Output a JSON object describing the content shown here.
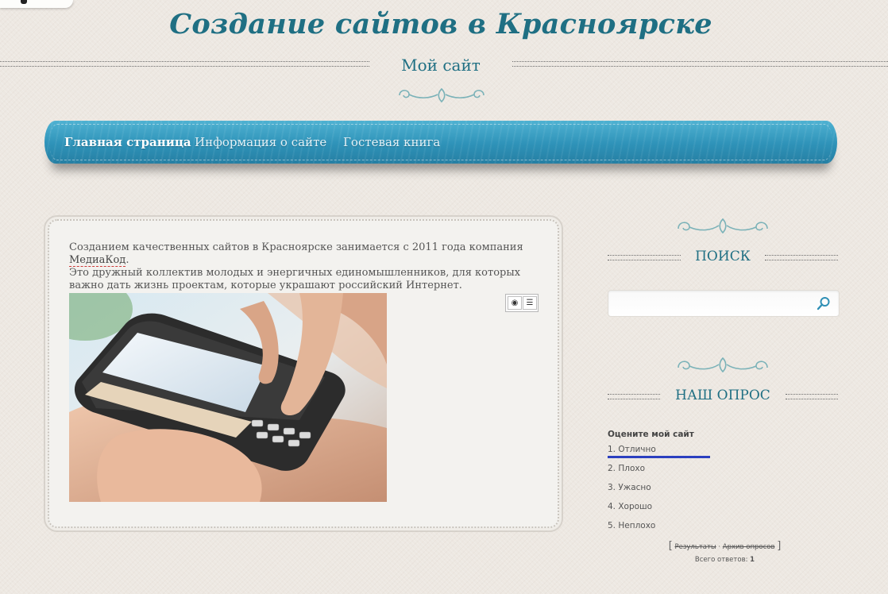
{
  "site": {
    "title": "Создание сайтов в Красноярске",
    "subtitle": "Мой сайт"
  },
  "nav": {
    "items": [
      {
        "label": "Главная страница",
        "active": true
      },
      {
        "label": "Информация о сайте",
        "active": false
      },
      {
        "label": "Гостевая книга",
        "active": false
      }
    ]
  },
  "content": {
    "intro_before_link": "Созданием качественных сайтов в Красноярске занимается с 2011 года компания",
    "company_link": "МедиаКод",
    "intro_after_link": ".",
    "line2": "Это дружный коллектив молодых и энергичных единомышленников, для которых важно дать жизнь проектам, которые украшают российский Интернет."
  },
  "sidebar": {
    "search_title": "ПОИСК",
    "search_placeholder": "",
    "poll_title": "НАШ ОПРОС"
  },
  "poll": {
    "question": "Оцените мой сайт",
    "options": [
      "1. Отлично",
      "2. Плохо",
      "3. Ужасно",
      "4. Хорошо",
      "5. Неплохо"
    ],
    "leading_share": 1.0,
    "results_link": "Результаты",
    "separator": "·",
    "archive_link": "Архив опросов",
    "bracket_open": "[",
    "bracket_close": "]",
    "total_label": "Всего ответов:",
    "total_value": "1"
  },
  "colors": {
    "accent": "#1f6f83",
    "nav": "#2e92b8",
    "poll_bar": "#2b3fbf"
  }
}
